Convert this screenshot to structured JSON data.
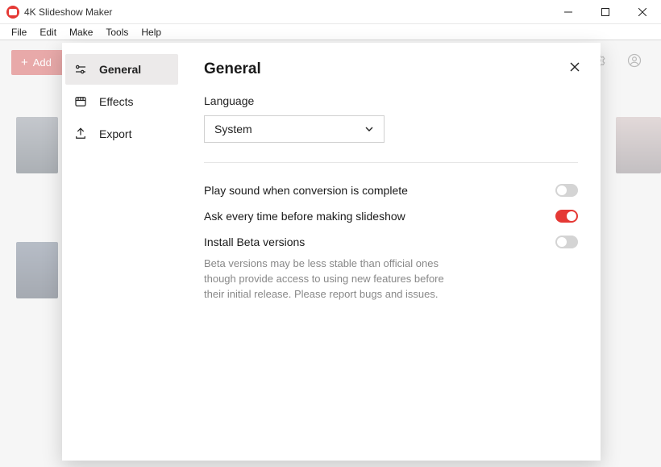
{
  "window": {
    "title": "4K Slideshow Maker"
  },
  "menubar": [
    "File",
    "Edit",
    "Make",
    "Tools",
    "Help"
  ],
  "toolbar": {
    "add_label": "Add"
  },
  "settings": {
    "title": "General",
    "sidebar": [
      {
        "id": "general",
        "label": "General",
        "active": true
      },
      {
        "id": "effects",
        "label": "Effects",
        "active": false
      },
      {
        "id": "export",
        "label": "Export",
        "active": false
      }
    ],
    "language": {
      "label": "Language",
      "value": "System"
    },
    "options": {
      "play_sound": {
        "label": "Play sound when conversion is complete",
        "value": false
      },
      "ask_before": {
        "label": "Ask every time before making slideshow",
        "value": true
      },
      "install_beta": {
        "label": "Install Beta versions",
        "value": false,
        "desc": "Beta versions may be less stable than official ones though provide access to using new features before their initial release. Please report bugs and issues."
      }
    }
  }
}
